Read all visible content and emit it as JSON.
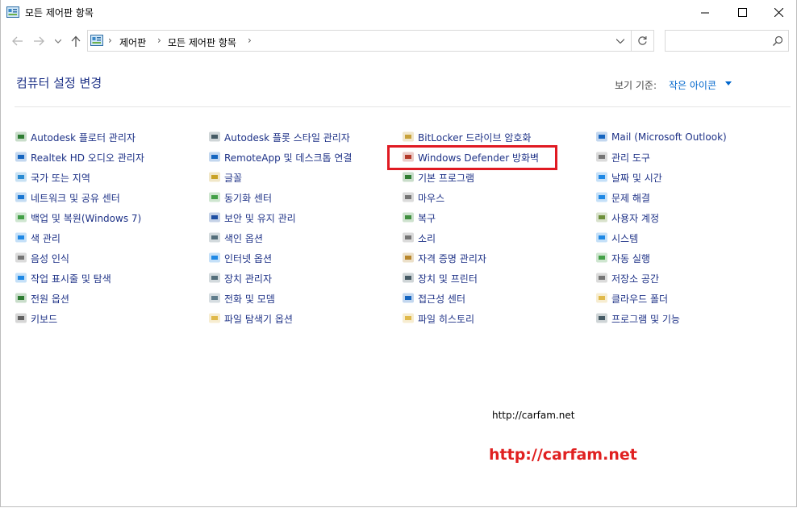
{
  "window": {
    "title": "모든 제어판 항목"
  },
  "address": {
    "crumbs": [
      "제어판",
      "모든 제어판 항목"
    ],
    "search_placeholder": ""
  },
  "header": {
    "title": "컴퓨터 설정 변경",
    "view_label": "보기 기준:",
    "view_value": "작은 아이콘"
  },
  "columns": [
    [
      {
        "label": "Autodesk 플로터 관리자",
        "icon": "plotter-icon"
      },
      {
        "label": "Realtek HD 오디오 관리자",
        "icon": "audio-manager-icon"
      },
      {
        "label": "국가 또는 지역",
        "icon": "globe-region-icon"
      },
      {
        "label": "네트워크 및 공유 센터",
        "icon": "network-icon"
      },
      {
        "label": "백업 및 복원(Windows 7)",
        "icon": "backup-icon"
      },
      {
        "label": "색 관리",
        "icon": "color-management-icon"
      },
      {
        "label": "음성 인식",
        "icon": "microphone-icon"
      },
      {
        "label": "작업 표시줄 및 탐색",
        "icon": "taskbar-icon"
      },
      {
        "label": "전원 옵션",
        "icon": "power-icon"
      },
      {
        "label": "키보드",
        "icon": "keyboard-icon"
      }
    ],
    [
      {
        "label": "Autodesk 플롯 스타일 관리자",
        "icon": "plot-style-icon"
      },
      {
        "label": "RemoteApp 및 데스크톱 연결",
        "icon": "remoteapp-icon"
      },
      {
        "label": "글꼴",
        "icon": "font-icon"
      },
      {
        "label": "동기화 센터",
        "icon": "sync-icon"
      },
      {
        "label": "보안 및 유지 관리",
        "icon": "security-flag-icon"
      },
      {
        "label": "색인 옵션",
        "icon": "indexing-icon"
      },
      {
        "label": "인터넷 옵션",
        "icon": "internet-icon"
      },
      {
        "label": "장치 관리자",
        "icon": "device-manager-icon"
      },
      {
        "label": "전화 및 모뎀",
        "icon": "phone-modem-icon"
      },
      {
        "label": "파일 탐색기 옵션",
        "icon": "folder-options-icon"
      }
    ],
    [
      {
        "label": "BitLocker 드라이브 암호화",
        "icon": "bitlocker-icon"
      },
      {
        "label": "Windows Defender 방화벽",
        "icon": "firewall-icon"
      },
      {
        "label": "기본 프로그램",
        "icon": "default-programs-icon"
      },
      {
        "label": "마우스",
        "icon": "mouse-icon"
      },
      {
        "label": "복구",
        "icon": "recovery-icon"
      },
      {
        "label": "소리",
        "icon": "speaker-icon"
      },
      {
        "label": "자격 증명 관리자",
        "icon": "credential-icon"
      },
      {
        "label": "장치 및 프린터",
        "icon": "printer-icon"
      },
      {
        "label": "접근성 센터",
        "icon": "accessibility-icon"
      },
      {
        "label": "파일 히스토리",
        "icon": "file-history-icon"
      }
    ],
    [
      {
        "label": "Mail (Microsoft Outlook)",
        "icon": "mail-icon"
      },
      {
        "label": "관리 도구",
        "icon": "admin-tools-icon"
      },
      {
        "label": "날짜 및 시간",
        "icon": "clock-icon"
      },
      {
        "label": "문제 해결",
        "icon": "troubleshoot-icon"
      },
      {
        "label": "사용자 계정",
        "icon": "user-accounts-icon"
      },
      {
        "label": "시스템",
        "icon": "system-icon"
      },
      {
        "label": "자동 실행",
        "icon": "autoplay-icon"
      },
      {
        "label": "저장소 공간",
        "icon": "storage-icon"
      },
      {
        "label": "클라우드 폴더",
        "icon": "cloud-folder-icon"
      },
      {
        "label": "프로그램 및 기능",
        "icon": "programs-features-icon"
      }
    ]
  ],
  "watermark": {
    "small": "http://carfam.net",
    "big": "http://carfam.net"
  },
  "colors": {
    "link": "#1e3287",
    "highlight": "#e01a22",
    "watermark": "#e02020"
  }
}
